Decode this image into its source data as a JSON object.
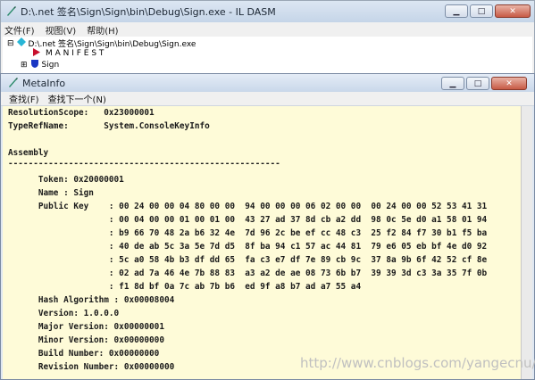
{
  "back_window": {
    "title": "D:\\.net 签名\\Sign\\Sign\\bin\\Debug\\Sign.exe - IL DASM",
    "menu": [
      "文件(F)",
      "视图(V)",
      "帮助(H)"
    ],
    "tree": {
      "root": "D:\\.net 签名\\Sign\\Sign\\bin\\Debug\\Sign.exe",
      "manifest": "M A N I F E S T",
      "sign": "Sign"
    }
  },
  "front_window": {
    "title": "MetaInfo",
    "menu": [
      "查找(F)",
      "查找下一个(N)"
    ],
    "lines": [
      "ResolutionScope:   0x23000001",
      "TypeRefName:       System.ConsoleKeyInfo",
      "",
      "Assembly",
      "------------------------------------------------------",
      "      Token: 0x20000001",
      "      Name : Sign",
      "      Public Key    : 00 24 00 00 04 80 00 00  94 00 00 00 06 02 00 00  00 24 00 00 52 53 41 31",
      "                    : 00 04 00 00 01 00 01 00  43 27 ad 37 8d cb a2 dd  98 0c 5e d0 a1 58 01 94",
      "                    : b9 66 70 48 2a b6 32 4e  7d 96 2c be ef cc 48 c3  25 f2 84 f7 30 b1 f5 ba",
      "                    : 40 de ab 5c 3a 5e 7d d5  8f ba 94 c1 57 ac 44 81  79 e6 05 eb bf 4e d0 92",
      "                    : 5c a0 58 4b b3 df dd 65  fa c3 e7 df 7e 89 cb 9c  37 8a 9b 6f 42 52 cf 8e",
      "                    : 02 ad 7a 46 4e 7b 88 83  a3 a2 de ae 08 73 6b b7  39 39 3d c3 3a 35 7f 0b",
      "                    : f1 8d bf 0a 7c ab 7b b6  ed 9f a8 b7 ad a7 55 a4",
      "      Hash Algorithm : 0x00008004",
      "      Version: 1.0.0.0",
      "      Major Version: 0x00000001",
      "      Minor Version: 0x00000000",
      "      Build Number: 0x00000000",
      "      Revision Number: 0x00000000"
    ]
  },
  "watermark": "http://www.cnblogs.com/yangecnu/",
  "colors": {
    "content_bg": "#fefbd8",
    "title_bg": "#c9d8ea",
    "close_button": "#c75a45"
  }
}
